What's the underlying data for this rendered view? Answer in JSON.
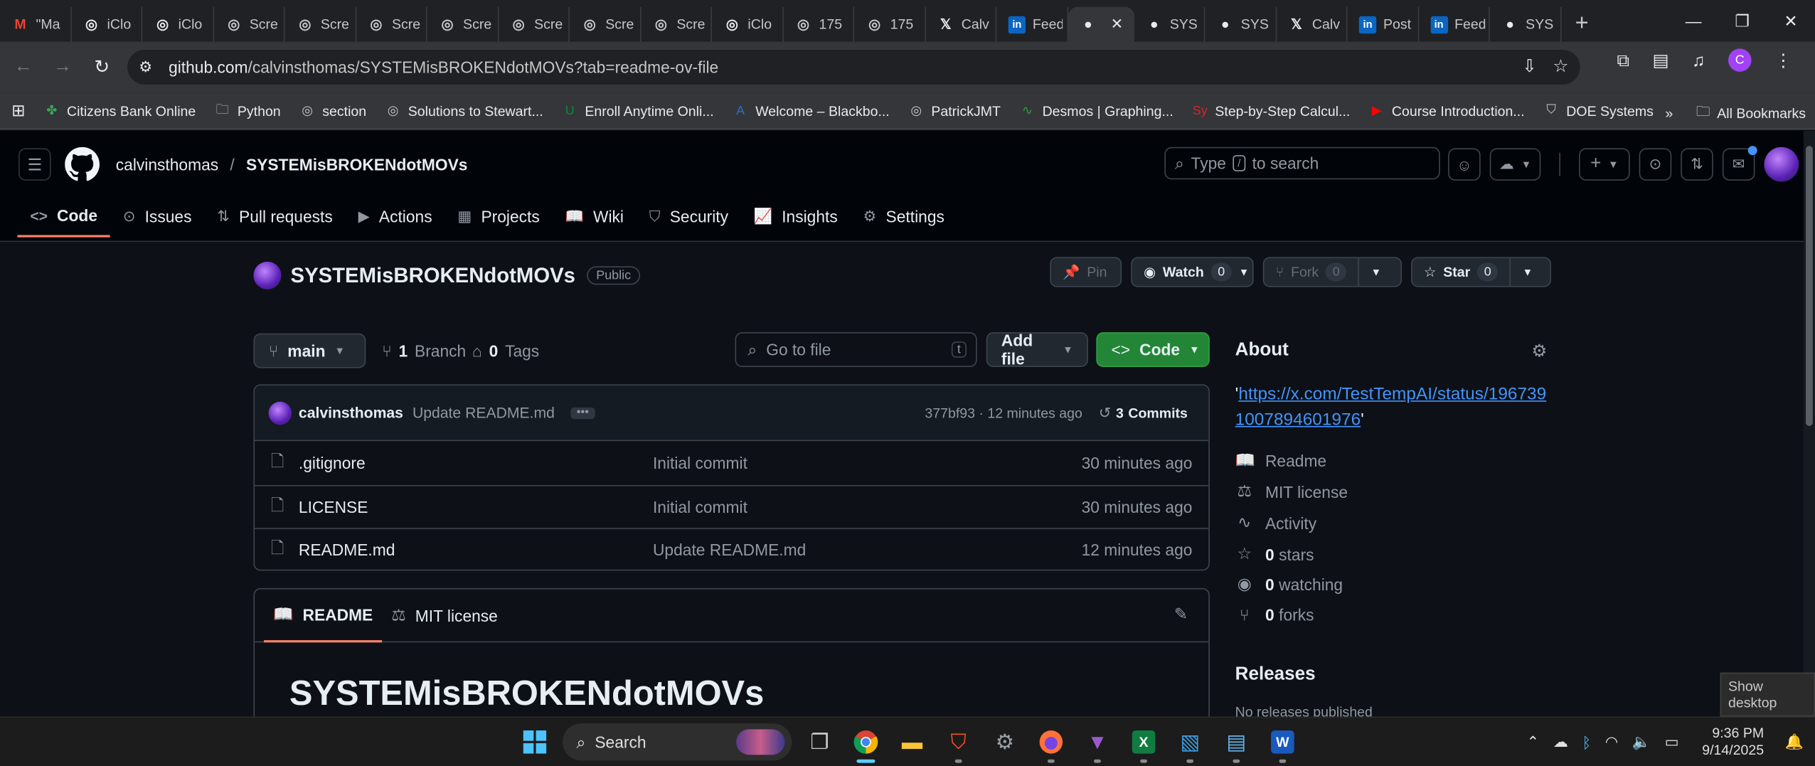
{
  "browser": {
    "tabs": [
      {
        "icon": "gmail-icon",
        "title": "\"Ma"
      },
      {
        "icon": "apple-icon",
        "title": "iClo"
      },
      {
        "icon": "apple-icon",
        "title": "iClo"
      },
      {
        "icon": "globe-icon",
        "title": "Scre"
      },
      {
        "icon": "globe-icon",
        "title": "Scre"
      },
      {
        "icon": "globe-icon",
        "title": "Scre"
      },
      {
        "icon": "globe-icon",
        "title": "Scre"
      },
      {
        "icon": "globe-icon",
        "title": "Scre"
      },
      {
        "icon": "globe-icon",
        "title": "Scre"
      },
      {
        "icon": "globe-icon",
        "title": "Scre"
      },
      {
        "icon": "apple-icon",
        "title": "iClo"
      },
      {
        "icon": "globe-icon",
        "title": "175"
      },
      {
        "icon": "globe-icon",
        "title": "175"
      },
      {
        "icon": "x-icon",
        "title": "Calv"
      },
      {
        "icon": "linkedin-icon",
        "title": "Feed"
      },
      {
        "icon": "github-icon",
        "title": "",
        "active": true
      },
      {
        "icon": "github-icon",
        "title": "SYS"
      },
      {
        "icon": "github-icon",
        "title": "SYS"
      },
      {
        "icon": "x-icon",
        "title": "Calv"
      },
      {
        "icon": "linkedin-icon",
        "title": "Post"
      },
      {
        "icon": "linkedin-icon",
        "title": "Feed"
      },
      {
        "icon": "github-icon",
        "title": "SYS"
      }
    ],
    "url_host": "github.com",
    "url_path": "/calvinsthomas/SYSTEMisBROKENdotMOVs?tab=readme-ov-file",
    "profile_initial": "C",
    "bookmarks": [
      {
        "icon": "citizens-icon",
        "label": "Citizens Bank Online"
      },
      {
        "icon": "folder-icon",
        "label": "Python"
      },
      {
        "icon": "globe-icon",
        "label": "section"
      },
      {
        "icon": "globe-icon",
        "label": "Solutions to Stewart..."
      },
      {
        "icon": "und-icon",
        "label": "Enroll Anytime Onli..."
      },
      {
        "icon": "blackboard-icon",
        "label": "Welcome – Blackbo..."
      },
      {
        "icon": "globe-icon",
        "label": "PatrickJMT"
      },
      {
        "icon": "desmos-icon",
        "label": "Desmos | Graphing..."
      },
      {
        "icon": "symbolab-icon",
        "label": "Step-by-Step Calcul..."
      },
      {
        "icon": "youtube-icon",
        "label": "Course Introduction..."
      },
      {
        "icon": "doe-icon",
        "label": "DOE Systems"
      }
    ],
    "all_bookmarks": "All Bookmarks"
  },
  "github": {
    "owner": "calvinsthomas",
    "repo": "SYSTEMisBROKENdotMOVs",
    "search_prefix": "Type",
    "search_key": "/",
    "search_suffix": "to search",
    "nav": [
      {
        "icon": "code-icon",
        "label": "Code",
        "glyph": "<>"
      },
      {
        "icon": "issue-icon",
        "label": "Issues",
        "glyph": "⊙"
      },
      {
        "icon": "pull-request-icon",
        "label": "Pull requests",
        "glyph": "⇅"
      },
      {
        "icon": "actions-icon",
        "label": "Actions",
        "glyph": "▶"
      },
      {
        "icon": "projects-icon",
        "label": "Projects",
        "glyph": "▦"
      },
      {
        "icon": "wiki-icon",
        "label": "Wiki",
        "glyph": "📖"
      },
      {
        "icon": "security-icon",
        "label": "Security",
        "glyph": "⛉"
      },
      {
        "icon": "insights-icon",
        "label": "Insights",
        "glyph": "📈"
      },
      {
        "icon": "settings-icon",
        "label": "Settings",
        "glyph": "⚙"
      }
    ],
    "visibility": "Public",
    "pin_label": "Pin",
    "watch_label": "Watch",
    "watch_count": "0",
    "fork_label": "Fork",
    "fork_count": "0",
    "star_label": "Star",
    "star_count": "0",
    "branch_name": "main",
    "branch_count": "1",
    "branch_label": "Branch",
    "tag_count": "0",
    "tag_label": "Tags",
    "gofile_placeholder": "Go to file",
    "gofile_key": "t",
    "add_file_label": "Add file",
    "code_button_label": "Code",
    "commit": {
      "author": "calvinsthomas",
      "message": "Update README.md",
      "hash_time": "377bf93 · 12 minutes ago",
      "commits_count": "3",
      "commits_label": "Commits"
    },
    "files": [
      {
        "name": ".gitignore",
        "message": "Initial commit",
        "time": "30 minutes ago"
      },
      {
        "name": "LICENSE",
        "message": "Initial commit",
        "time": "30 minutes ago"
      },
      {
        "name": "README.md",
        "message": "Update README.md",
        "time": "12 minutes ago"
      }
    ],
    "readme_tab": "README",
    "license_tab": "MIT license",
    "readme_title": "SYSTEMisBROKENdotMOVs",
    "about": {
      "heading": "About",
      "link_open_quote": "'",
      "link": "https://x.com/TestTempAI/status/1967391007894601976",
      "link_close_quote": "'",
      "readme": "Readme",
      "license": "MIT license",
      "activity": "Activity",
      "stars_count": "0",
      "stars_label": "stars",
      "watching_count": "0",
      "watching_label": "watching",
      "forks_count": "0",
      "forks_label": "forks"
    },
    "releases_heading": "Releases",
    "releases_none": "No releases published"
  },
  "os": {
    "show_desktop": "Show desktop",
    "search_label": "Search",
    "time": "9:36 PM",
    "date": "9/14/2025"
  }
}
